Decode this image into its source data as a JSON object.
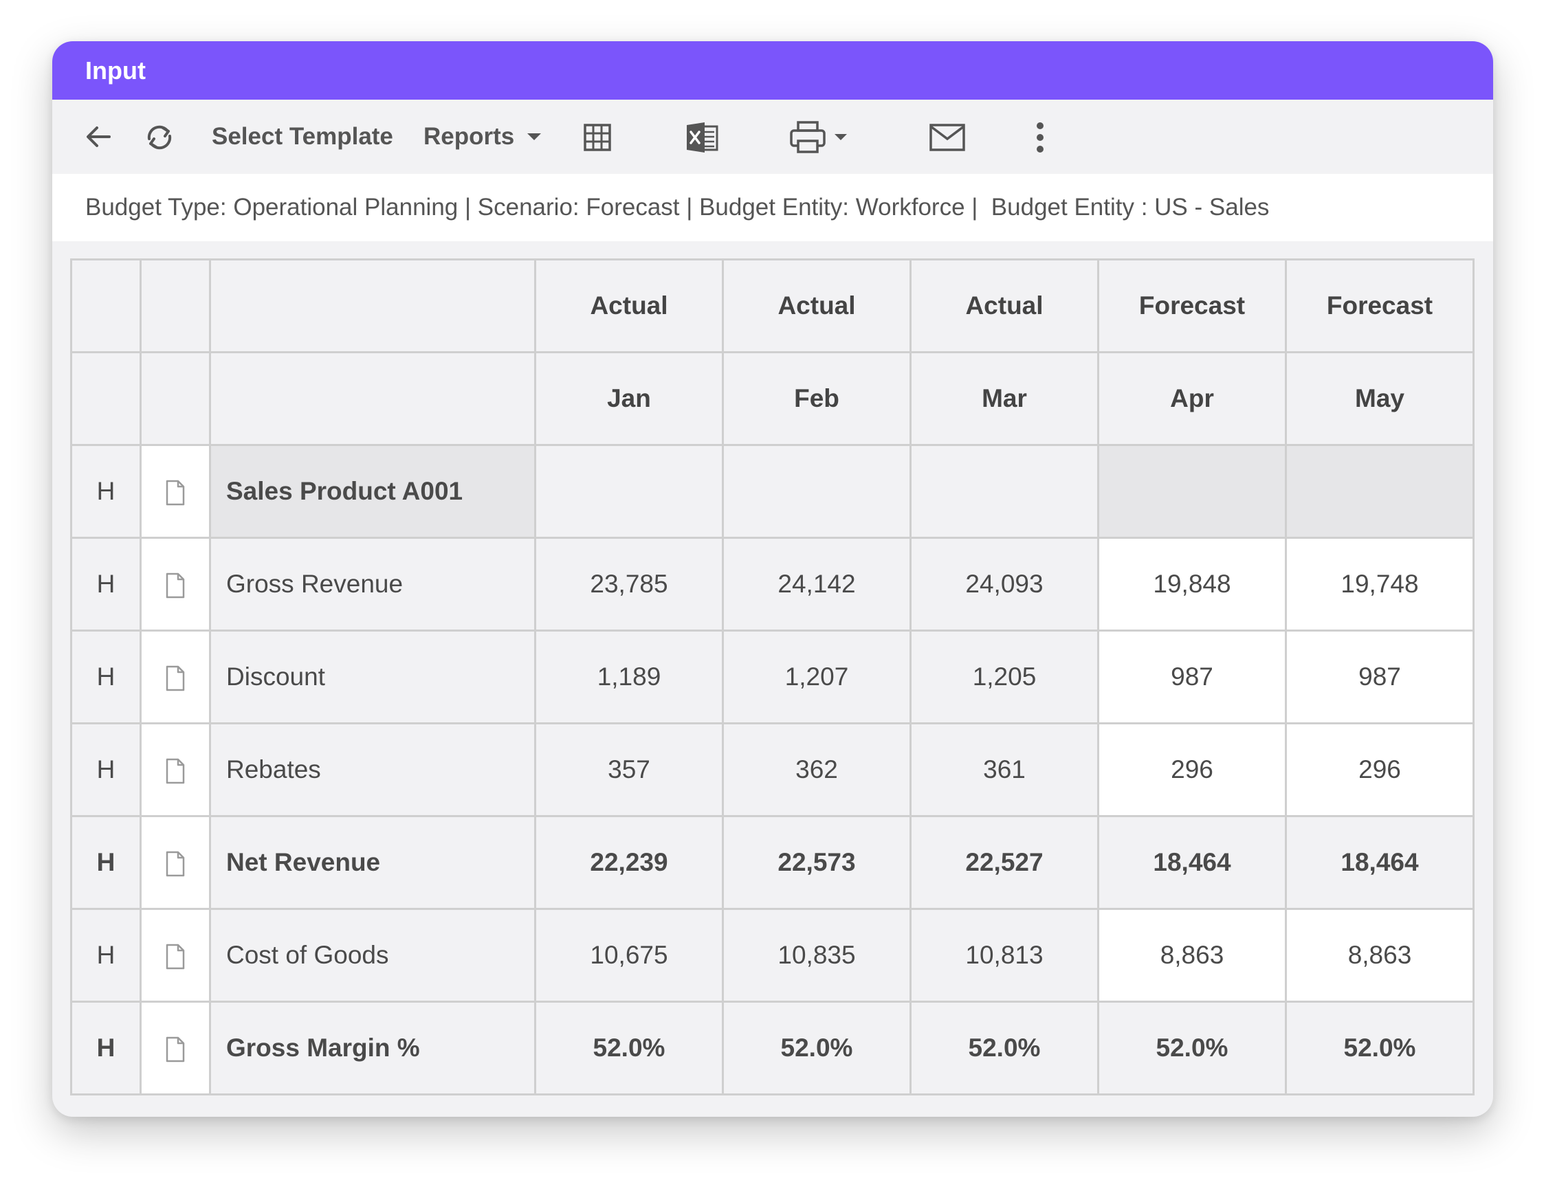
{
  "window": {
    "title": "Input"
  },
  "toolbar": {
    "select_template": "Select Template",
    "reports": "Reports"
  },
  "context": {
    "text": "Budget Type: Operational Planning | Scenario: Forecast | Budget Entity: Workforce |  Budget Entity : US - Sales"
  },
  "grid": {
    "header_scenarios": [
      "Actual",
      "Actual",
      "Actual",
      "Forecast",
      "Forecast"
    ],
    "header_months": [
      "Jan",
      "Feb",
      "Mar",
      "Apr",
      "May"
    ],
    "rows": [
      {
        "flag": "H",
        "label": "Sales Product A001",
        "values": [
          "",
          "",
          "",
          "",
          ""
        ]
      },
      {
        "flag": "H",
        "label": "Gross Revenue",
        "values": [
          "23,785",
          "24,142",
          "24,093",
          "19,848",
          "19,748"
        ]
      },
      {
        "flag": "H",
        "label": "Discount",
        "values": [
          "1,189",
          "1,207",
          "1,205",
          "987",
          "987"
        ]
      },
      {
        "flag": "H",
        "label": "Rebates",
        "values": [
          "357",
          "362",
          "361",
          "296",
          "296"
        ]
      },
      {
        "flag": "H",
        "label": "Net Revenue",
        "values": [
          "22,239",
          "22,573",
          "22,527",
          "18,464",
          "18,464"
        ]
      },
      {
        "flag": "H",
        "label": "Cost of Goods",
        "values": [
          "10,675",
          "10,835",
          "10,813",
          "8,863",
          "8,863"
        ]
      },
      {
        "flag": "H",
        "label": "Gross Margin %",
        "values": [
          "52.0%",
          "52.0%",
          "52.0%",
          "52.0%",
          "52.0%"
        ]
      }
    ]
  },
  "colors": {
    "accent": "#7b55fb",
    "panel": "#f2f2f4",
    "grid_line": "#cfcfcf",
    "editable_cell": "#ffffff",
    "header_row_cell": "#e6e6e8"
  }
}
